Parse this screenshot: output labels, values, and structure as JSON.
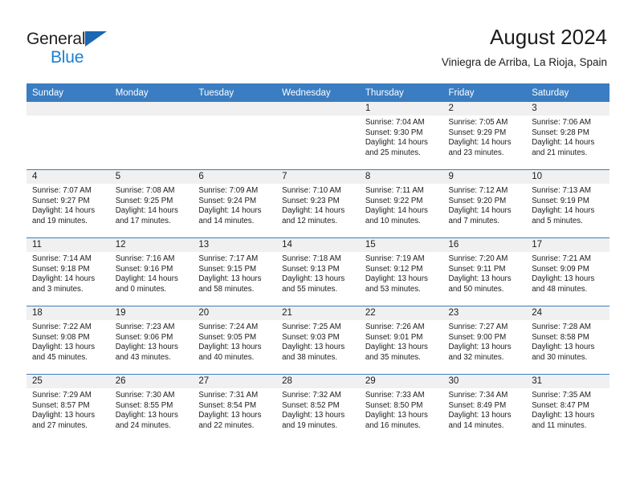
{
  "brand": {
    "name_part1": "General",
    "name_part2": "Blue",
    "triangle_color": "#1a67b3",
    "blue_color": "#1a7fd4"
  },
  "header": {
    "title": "August 2024",
    "subtitle": "Viniegra de Arriba, La Rioja, Spain"
  },
  "theme": {
    "header_row_bg": "#3a7dc2",
    "daynum_band_bg": "#f0f0f0",
    "grid_line": "#3a7dc2"
  },
  "weekday_headers": [
    "Sunday",
    "Monday",
    "Tuesday",
    "Wednesday",
    "Thursday",
    "Friday",
    "Saturday"
  ],
  "labels": {
    "sunrise_prefix": "Sunrise:",
    "sunset_prefix": "Sunset:",
    "daylight_prefix": "Daylight:"
  },
  "weeks": [
    [
      {
        "day": "",
        "empty": true,
        "line1": "",
        "line2": "",
        "line3": "",
        "line4": ""
      },
      {
        "day": "",
        "empty": true,
        "line1": "",
        "line2": "",
        "line3": "",
        "line4": ""
      },
      {
        "day": "",
        "empty": true,
        "line1": "",
        "line2": "",
        "line3": "",
        "line4": ""
      },
      {
        "day": "",
        "empty": true,
        "line1": "",
        "line2": "",
        "line3": "",
        "line4": ""
      },
      {
        "day": "1",
        "empty": false,
        "line1": "Sunrise: 7:04 AM",
        "line2": "Sunset: 9:30 PM",
        "line3": "Daylight: 14 hours",
        "line4": "and 25 minutes."
      },
      {
        "day": "2",
        "empty": false,
        "line1": "Sunrise: 7:05 AM",
        "line2": "Sunset: 9:29 PM",
        "line3": "Daylight: 14 hours",
        "line4": "and 23 minutes."
      },
      {
        "day": "3",
        "empty": false,
        "line1": "Sunrise: 7:06 AM",
        "line2": "Sunset: 9:28 PM",
        "line3": "Daylight: 14 hours",
        "line4": "and 21 minutes."
      }
    ],
    [
      {
        "day": "4",
        "empty": false,
        "line1": "Sunrise: 7:07 AM",
        "line2": "Sunset: 9:27 PM",
        "line3": "Daylight: 14 hours",
        "line4": "and 19 minutes."
      },
      {
        "day": "5",
        "empty": false,
        "line1": "Sunrise: 7:08 AM",
        "line2": "Sunset: 9:25 PM",
        "line3": "Daylight: 14 hours",
        "line4": "and 17 minutes."
      },
      {
        "day": "6",
        "empty": false,
        "line1": "Sunrise: 7:09 AM",
        "line2": "Sunset: 9:24 PM",
        "line3": "Daylight: 14 hours",
        "line4": "and 14 minutes."
      },
      {
        "day": "7",
        "empty": false,
        "line1": "Sunrise: 7:10 AM",
        "line2": "Sunset: 9:23 PM",
        "line3": "Daylight: 14 hours",
        "line4": "and 12 minutes."
      },
      {
        "day": "8",
        "empty": false,
        "line1": "Sunrise: 7:11 AM",
        "line2": "Sunset: 9:22 PM",
        "line3": "Daylight: 14 hours",
        "line4": "and 10 minutes."
      },
      {
        "day": "9",
        "empty": false,
        "line1": "Sunrise: 7:12 AM",
        "line2": "Sunset: 9:20 PM",
        "line3": "Daylight: 14 hours",
        "line4": "and 7 minutes."
      },
      {
        "day": "10",
        "empty": false,
        "line1": "Sunrise: 7:13 AM",
        "line2": "Sunset: 9:19 PM",
        "line3": "Daylight: 14 hours",
        "line4": "and 5 minutes."
      }
    ],
    [
      {
        "day": "11",
        "empty": false,
        "line1": "Sunrise: 7:14 AM",
        "line2": "Sunset: 9:18 PM",
        "line3": "Daylight: 14 hours",
        "line4": "and 3 minutes."
      },
      {
        "day": "12",
        "empty": false,
        "line1": "Sunrise: 7:16 AM",
        "line2": "Sunset: 9:16 PM",
        "line3": "Daylight: 14 hours",
        "line4": "and 0 minutes."
      },
      {
        "day": "13",
        "empty": false,
        "line1": "Sunrise: 7:17 AM",
        "line2": "Sunset: 9:15 PM",
        "line3": "Daylight: 13 hours",
        "line4": "and 58 minutes."
      },
      {
        "day": "14",
        "empty": false,
        "line1": "Sunrise: 7:18 AM",
        "line2": "Sunset: 9:13 PM",
        "line3": "Daylight: 13 hours",
        "line4": "and 55 minutes."
      },
      {
        "day": "15",
        "empty": false,
        "line1": "Sunrise: 7:19 AM",
        "line2": "Sunset: 9:12 PM",
        "line3": "Daylight: 13 hours",
        "line4": "and 53 minutes."
      },
      {
        "day": "16",
        "empty": false,
        "line1": "Sunrise: 7:20 AM",
        "line2": "Sunset: 9:11 PM",
        "line3": "Daylight: 13 hours",
        "line4": "and 50 minutes."
      },
      {
        "day": "17",
        "empty": false,
        "line1": "Sunrise: 7:21 AM",
        "line2": "Sunset: 9:09 PM",
        "line3": "Daylight: 13 hours",
        "line4": "and 48 minutes."
      }
    ],
    [
      {
        "day": "18",
        "empty": false,
        "line1": "Sunrise: 7:22 AM",
        "line2": "Sunset: 9:08 PM",
        "line3": "Daylight: 13 hours",
        "line4": "and 45 minutes."
      },
      {
        "day": "19",
        "empty": false,
        "line1": "Sunrise: 7:23 AM",
        "line2": "Sunset: 9:06 PM",
        "line3": "Daylight: 13 hours",
        "line4": "and 43 minutes."
      },
      {
        "day": "20",
        "empty": false,
        "line1": "Sunrise: 7:24 AM",
        "line2": "Sunset: 9:05 PM",
        "line3": "Daylight: 13 hours",
        "line4": "and 40 minutes."
      },
      {
        "day": "21",
        "empty": false,
        "line1": "Sunrise: 7:25 AM",
        "line2": "Sunset: 9:03 PM",
        "line3": "Daylight: 13 hours",
        "line4": "and 38 minutes."
      },
      {
        "day": "22",
        "empty": false,
        "line1": "Sunrise: 7:26 AM",
        "line2": "Sunset: 9:01 PM",
        "line3": "Daylight: 13 hours",
        "line4": "and 35 minutes."
      },
      {
        "day": "23",
        "empty": false,
        "line1": "Sunrise: 7:27 AM",
        "line2": "Sunset: 9:00 PM",
        "line3": "Daylight: 13 hours",
        "line4": "and 32 minutes."
      },
      {
        "day": "24",
        "empty": false,
        "line1": "Sunrise: 7:28 AM",
        "line2": "Sunset: 8:58 PM",
        "line3": "Daylight: 13 hours",
        "line4": "and 30 minutes."
      }
    ],
    [
      {
        "day": "25",
        "empty": false,
        "line1": "Sunrise: 7:29 AM",
        "line2": "Sunset: 8:57 PM",
        "line3": "Daylight: 13 hours",
        "line4": "and 27 minutes."
      },
      {
        "day": "26",
        "empty": false,
        "line1": "Sunrise: 7:30 AM",
        "line2": "Sunset: 8:55 PM",
        "line3": "Daylight: 13 hours",
        "line4": "and 24 minutes."
      },
      {
        "day": "27",
        "empty": false,
        "line1": "Sunrise: 7:31 AM",
        "line2": "Sunset: 8:54 PM",
        "line3": "Daylight: 13 hours",
        "line4": "and 22 minutes."
      },
      {
        "day": "28",
        "empty": false,
        "line1": "Sunrise: 7:32 AM",
        "line2": "Sunset: 8:52 PM",
        "line3": "Daylight: 13 hours",
        "line4": "and 19 minutes."
      },
      {
        "day": "29",
        "empty": false,
        "line1": "Sunrise: 7:33 AM",
        "line2": "Sunset: 8:50 PM",
        "line3": "Daylight: 13 hours",
        "line4": "and 16 minutes."
      },
      {
        "day": "30",
        "empty": false,
        "line1": "Sunrise: 7:34 AM",
        "line2": "Sunset: 8:49 PM",
        "line3": "Daylight: 13 hours",
        "line4": "and 14 minutes."
      },
      {
        "day": "31",
        "empty": false,
        "line1": "Sunrise: 7:35 AM",
        "line2": "Sunset: 8:47 PM",
        "line3": "Daylight: 13 hours",
        "line4": "and 11 minutes."
      }
    ]
  ]
}
